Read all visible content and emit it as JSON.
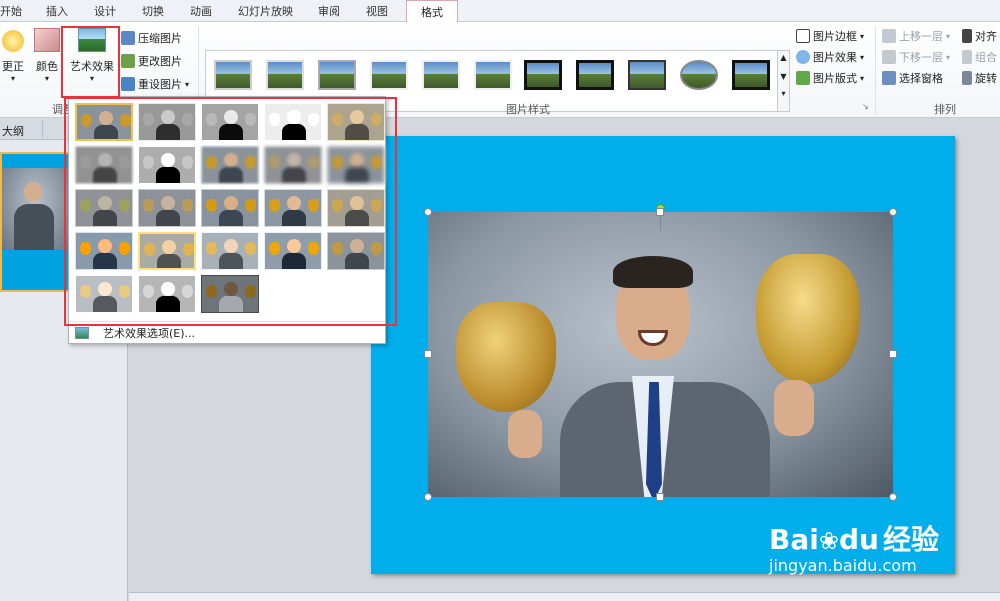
{
  "tabs": {
    "items": [
      "开始",
      "插入",
      "设计",
      "切换",
      "动画",
      "幻灯片放映",
      "审阅",
      "视图"
    ],
    "active": "格式"
  },
  "ribbon": {
    "adjust": {
      "correct_label": "更正",
      "color_label": "颜色",
      "art_effect_label": "艺术效果",
      "compress_label": "压缩图片",
      "change_label": "更改图片",
      "reset_label": "重设图片",
      "group_label": "调整"
    },
    "styles": {
      "group_label": "图片样式",
      "border_label": "图片边框",
      "effect_label": "图片效果",
      "layout_label": "图片版式"
    },
    "arrange": {
      "group_label": "排列",
      "bring_forward": "上移一层",
      "send_backward": "下移一层",
      "selection_pane": "选择窗格",
      "align": "对齐",
      "group": "组合",
      "rotate": "旋转"
    }
  },
  "left_panel": {
    "outline_tab": "大纲"
  },
  "dropdown": {
    "options_label": "艺术效果选项(E)...",
    "selected_index": 0,
    "hover_index": 16,
    "effect_count": 23
  },
  "watermark": {
    "brand": "Bai",
    "brand2": "du",
    "cn": "经验",
    "url": "jingyan.baidu.com"
  },
  "colors": {
    "slide_bg": "#00aeec",
    "highlight": "#e8323c",
    "selected": "#f2c14e"
  }
}
